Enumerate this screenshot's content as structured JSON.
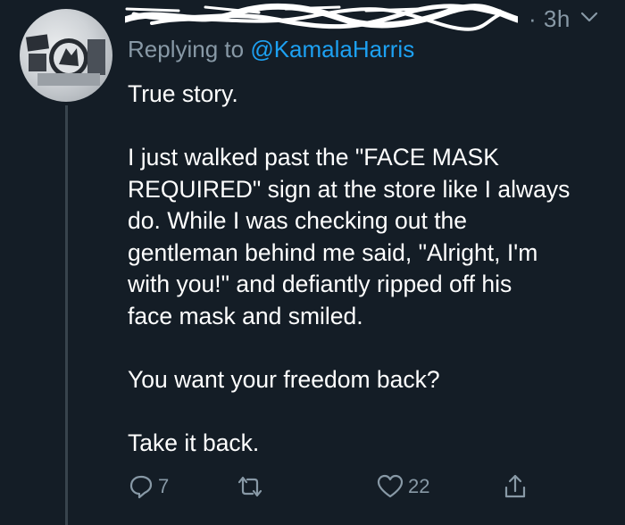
{
  "tweet": {
    "time": "· 3h",
    "replying_prefix": "Replying to ",
    "replying_handle": "@KamalaHarris",
    "body_lines": [
      "True story.",
      "",
      "I just walked past the \"FACE MASK",
      "REQUIRED\" sign at the store like I always",
      "do. While I was checking out the",
      "gentleman behind me said, \"Alright, I'm",
      "with you!\" and defiantly ripped off his",
      "face mask and smiled.",
      "",
      "You want your freedom back?",
      "",
      "Take it back."
    ],
    "actions": {
      "reply_icon": "reply-icon",
      "reply_count": "7",
      "retweet_icon": "retweet-icon",
      "like_icon": "heart-icon",
      "like_count": "22",
      "share_icon": "share-icon"
    }
  },
  "colors": {
    "background": "#141d26",
    "text": "#ffffff",
    "secondary": "#8899a6",
    "accent": "#1da1f2",
    "thread_line": "#38444d"
  }
}
